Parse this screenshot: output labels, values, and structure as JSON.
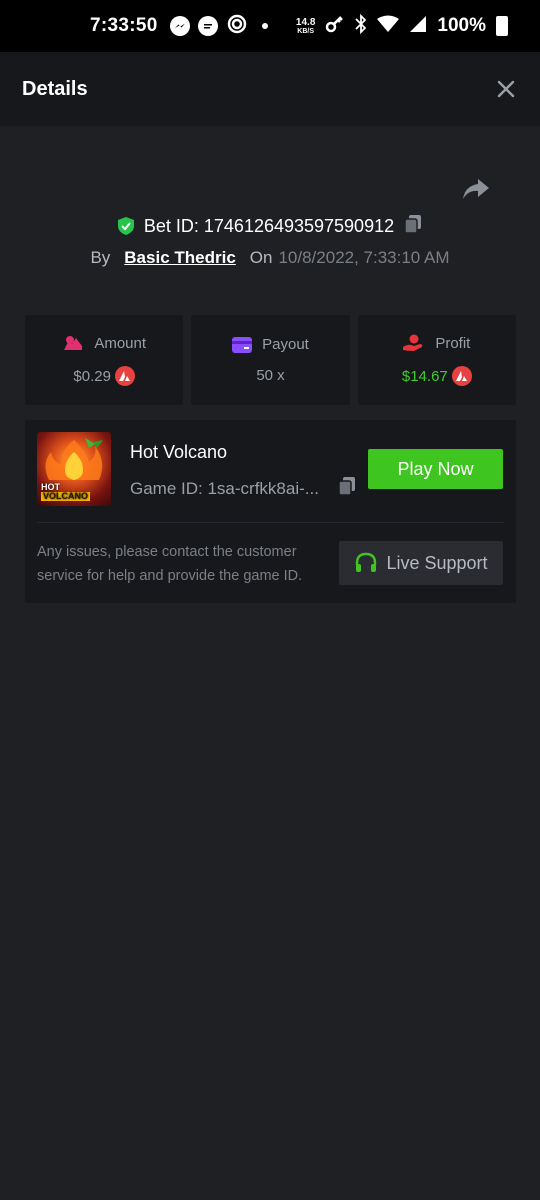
{
  "status_bar": {
    "time": "7:33:50",
    "net_speed_value": "14.8",
    "net_speed_unit": "KB/S",
    "battery": "100%"
  },
  "header": {
    "title": "Details"
  },
  "bet": {
    "id_text": "Bet ID: 1746126493597590912",
    "by_label": "By",
    "user": "Basic Thedric",
    "on_label": "On",
    "date": "10/8/2022, 7:33:10 AM"
  },
  "stats": [
    {
      "label": "Amount",
      "value": "$0.29",
      "icon": "money-bag-icon",
      "color": "#e0306f"
    },
    {
      "label": "Payout",
      "value": "50 x",
      "icon": "card-icon",
      "color": "#8a4dff"
    },
    {
      "label": "Profit",
      "value": "$14.67",
      "icon": "hand-coin-icon",
      "color": "#e8333a"
    }
  ],
  "game": {
    "name": "Hot Volcano",
    "id_text": "Game ID: 1sa-crfkk8ai-...",
    "thumb_title_line1": "HOT",
    "thumb_title_line2": "VOLCANO",
    "play_label": "Play Now",
    "issue_text": "Any issues, please contact the customer service for help and provide the game ID.",
    "support_label": "Live Support"
  },
  "colors": {
    "accent_green": "#3ec51f",
    "profit_green": "#3fcc2e",
    "avax_red": "#e84142"
  }
}
